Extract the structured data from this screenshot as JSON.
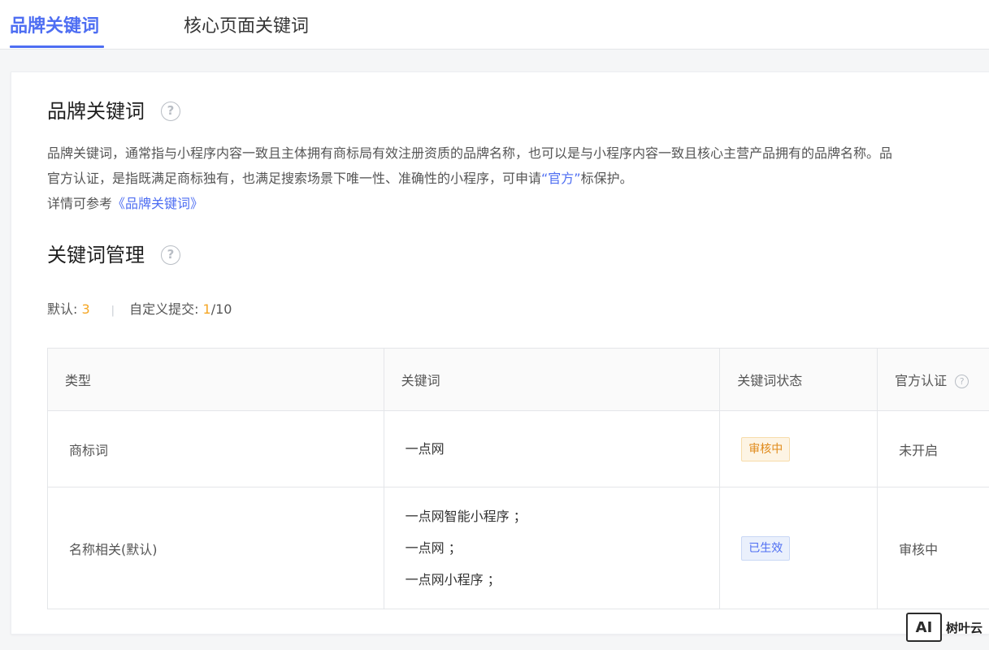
{
  "tabs": [
    {
      "label": "品牌关键词",
      "active": true
    },
    {
      "label": "核心页面关键词",
      "active": false
    }
  ],
  "section1": {
    "title": "品牌关键词",
    "desc_line1": "品牌关键词，通常指与小程序内容一致且主体拥有商标局有效注册资质的品牌名称，也可以是与小程序内容一致且核心主营产品拥有的品牌名称。品",
    "desc_line2_a": "官方认证，是指既满足商标独有，也满足搜索场景下唯一性、准确性的小程序，可申请",
    "desc_line2_link": "“官方”",
    "desc_line2_b": "标保护。",
    "desc_line3_a": "详情可参考",
    "desc_line3_link": "《品牌关键词》"
  },
  "section2": {
    "title": "关键词管理",
    "default_label": "默认: ",
    "default_count": "3",
    "separator": "|",
    "custom_label": "自定义提交: ",
    "custom_used": "1",
    "custom_total": "/10"
  },
  "table": {
    "headers": [
      "类型",
      "关键词",
      "关键词状态",
      "官方认证"
    ],
    "rows": [
      {
        "type": "商标词",
        "keywords": [
          "一点网"
        ],
        "status": "审核中",
        "official": "未开启"
      },
      {
        "type": "名称相关(默认)",
        "keywords": [
          "一点网智能小程序 ；",
          "一点网 ；",
          "一点网小程序 ；"
        ],
        "status": "已生效",
        "official": "审核中"
      }
    ]
  },
  "watermark": {
    "logo_text": "AI",
    "brand": "树叶云"
  },
  "colors": {
    "accent": "#4e6ef2",
    "orange": "#f5a623",
    "pending_badge": "#e08a1a"
  },
  "icons": {
    "help": "?"
  }
}
